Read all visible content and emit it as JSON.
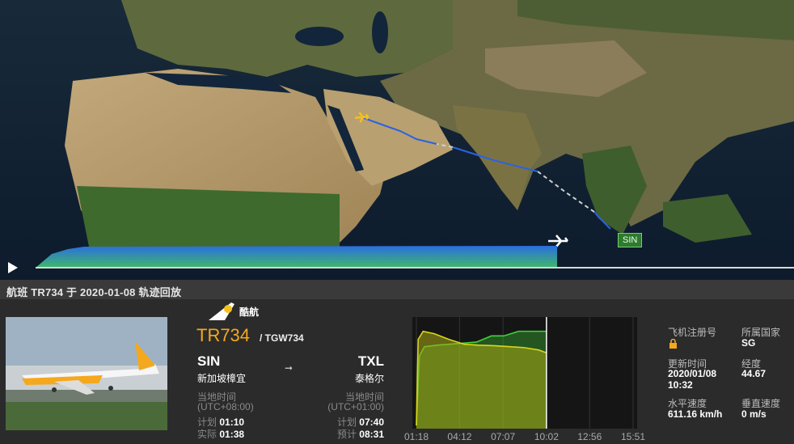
{
  "map": {
    "origin_label": "SIN"
  },
  "header": {
    "title": "航班 TR734 于 2020-01-08 轨迹回放"
  },
  "flight": {
    "airline_name": "酷航",
    "number": "TR734",
    "icao": "/ TGW734",
    "departure": {
      "code": "SIN",
      "city": "新加坡樟宜",
      "tz_label": "当地时间",
      "tz": "(UTC+08:00)",
      "sched_label": "计划",
      "sched": "01:10",
      "actual_label": "实际",
      "actual": "01:38"
    },
    "arrival": {
      "code": "TXL",
      "city": "泰格尔",
      "tz_label": "当地时间",
      "tz": "(UTC+01:00)",
      "sched_label": "计划",
      "sched": "07:40",
      "est_label": "预计",
      "est": "08:31"
    }
  },
  "chart_data": {
    "type": "area",
    "x_ticks": [
      "01:18",
      "04:12",
      "07:07",
      "10:02",
      "12:56",
      "15:51"
    ],
    "series": [
      {
        "color": "#42d13a",
        "x": [
          "01:18",
          "01:30",
          "01:50",
          "02:40",
          "04:00",
          "05:20",
          "06:20",
          "07:10",
          "08:10",
          "09:00",
          "10:02"
        ],
        "values": [
          0,
          9000,
          10200,
          10400,
          10600,
          10800,
          11600,
          11600,
          12200,
          12200,
          12200
        ]
      },
      {
        "color": "#d8d81a",
        "x": [
          "01:18",
          "01:25",
          "01:45",
          "02:30",
          "03:30",
          "04:30",
          "05:30",
          "06:30",
          "07:30",
          "08:30",
          "09:30",
          "10:02"
        ],
        "values": [
          0,
          900,
          985,
          960,
          900,
          850,
          840,
          835,
          825,
          815,
          790,
          760
        ]
      }
    ],
    "current_time": "10:02"
  },
  "facts": {
    "reg_label": "飞机注册号",
    "country_label": "所属国家",
    "country": "SG",
    "updated_label": "更新时间",
    "updated_date": "2020/01/08",
    "updated_time": "10:32",
    "lon_label": "经度",
    "lon": "44.67",
    "hspeed_label": "水平速度",
    "hspeed": "611.16 km/h",
    "vspeed_label": "垂直速度",
    "vspeed": "0 m/s"
  },
  "colors": {
    "accent": "#f4a81e",
    "track_flown": "#2a63e0",
    "track_planned": "#d0d0d0"
  }
}
